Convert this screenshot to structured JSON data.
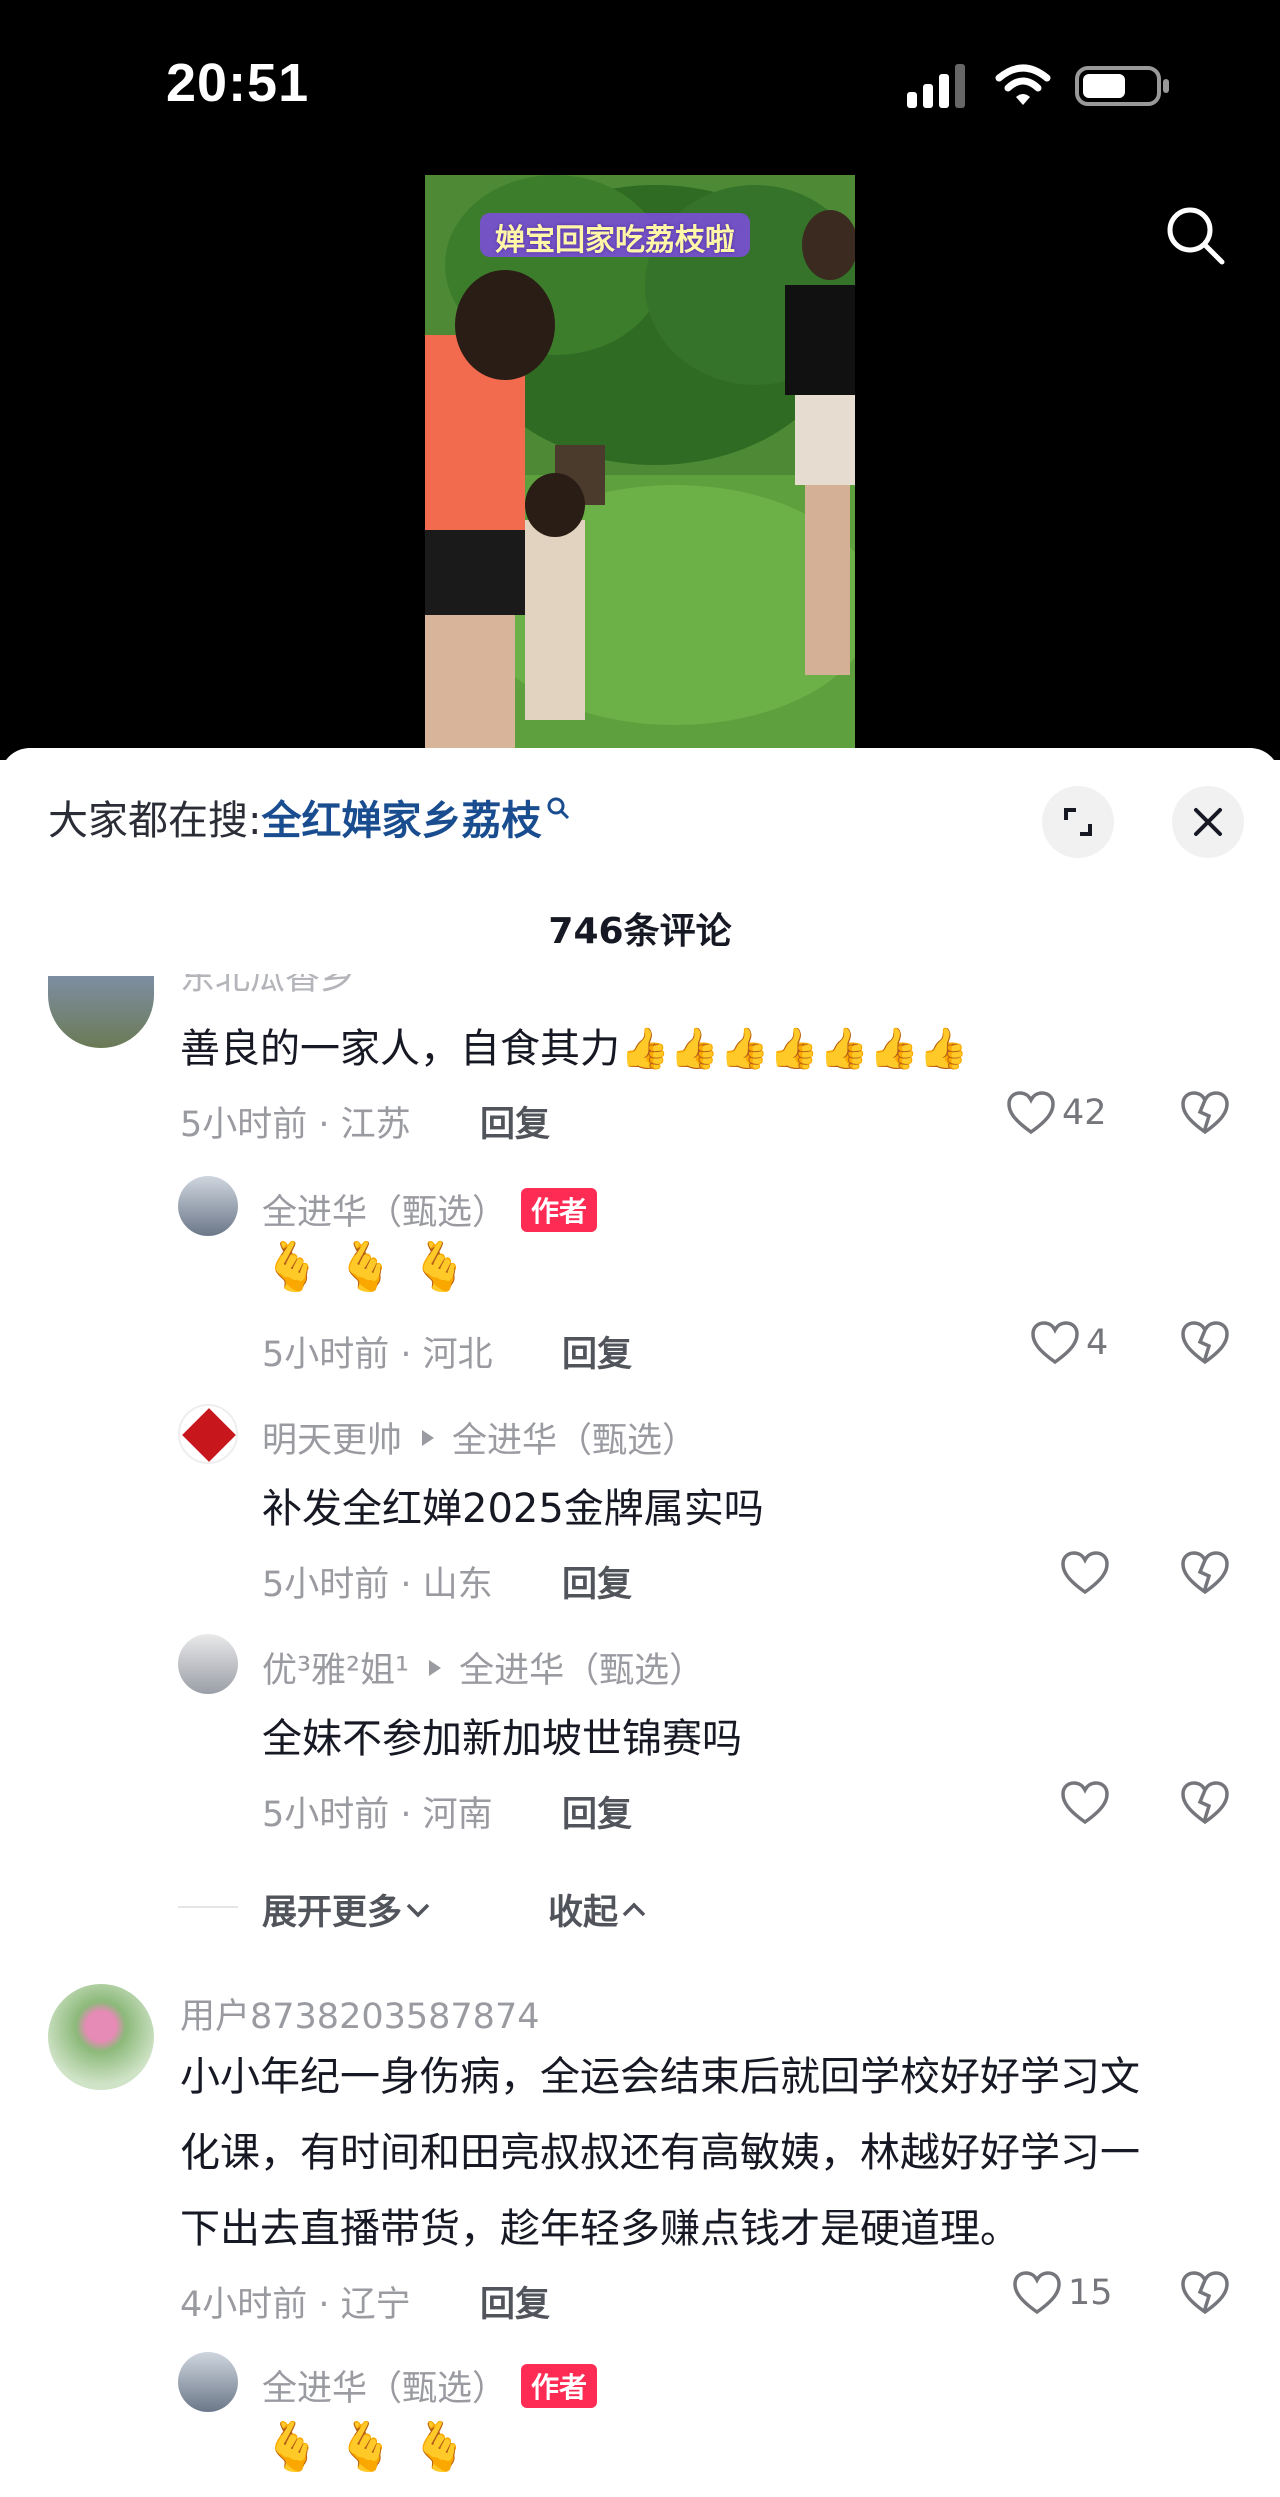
{
  "status_bar": {
    "time": "20:51"
  },
  "video": {
    "caption": "婵宝回家吃荔枝啦"
  },
  "sheet": {
    "hot_prefix": "大家都在搜:",
    "hot_query": "全红婵家乡荔枝",
    "comment_count": "746条评论",
    "reply_label": "回复"
  },
  "comments": [
    {
      "user": "东北瓜香乡",
      "text": "善良的一家人，自食其力👍👍👍👍👍👍👍",
      "time": "5小时前 · 江苏",
      "likes": "42"
    },
    {
      "user": "全进华（甄选）",
      "tag": "作者",
      "text": "🫰🫰🫰",
      "time": "5小时前 · 河北",
      "likes": "4"
    },
    {
      "user": "明天更帅",
      "reply_to": "全进华（甄选）",
      "text": "补发全红婵2025金牌属实吗",
      "time": "5小时前 · 山东",
      "likes": ""
    },
    {
      "user": "优³雅²姐¹",
      "reply_to": "全进华（甄选）",
      "text": "全妹不参加新加坡世锦赛吗",
      "time": "5小时前 · 河南",
      "likes": ""
    },
    {
      "user": "用户8738203587874",
      "text_lines": [
        "小小年纪一身伤病，全运会结束后就回学校好好学习文",
        "化课，有时间和田亮叔叔还有高敏姨，林越好好学习一",
        "下出去直播带货，趁年轻多赚点钱才是硬道理。"
      ],
      "time": "4小时前 · 辽宁",
      "likes": "15"
    },
    {
      "user": "全进华（甄选）",
      "tag": "作者",
      "text": "🫰🫰🫰"
    }
  ],
  "thread_controls": {
    "expand": "展开更多",
    "collapse": "收起"
  },
  "icons": [
    "search-icon",
    "expand-icon",
    "close-icon",
    "heart-icon",
    "broken-heart-icon",
    "chevron-down-icon",
    "chevron-up-icon",
    "small-search-icon",
    "play-arrow-icon"
  ],
  "colors": {
    "link": "#1a4d8f",
    "author_tag": "#fe2c55",
    "muted": "#9a9ba1"
  }
}
